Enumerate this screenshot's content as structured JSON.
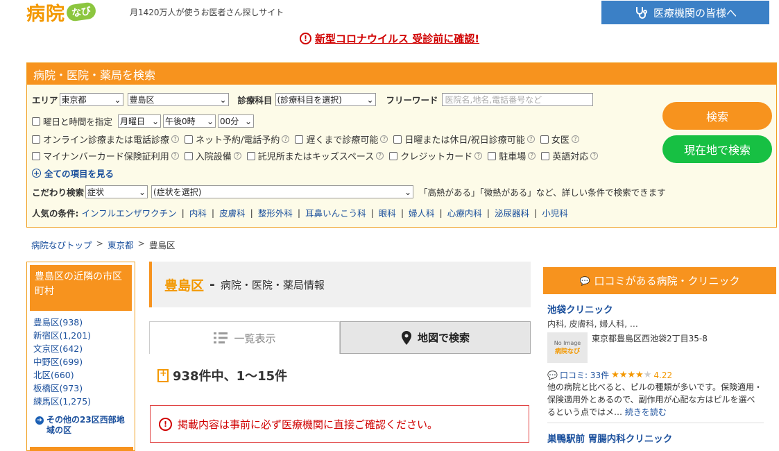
{
  "header": {
    "logo_main": "病院",
    "logo_badge": "なび",
    "tagline": "月1420万人が使うお医者さん探しサイト",
    "top_button": "医療機関の皆様へ",
    "alert": "新型コロナウイルス 受診前に確認!"
  },
  "search": {
    "title": "病院・医院・薬局を検索",
    "area_label": "エリア",
    "area_pref": "東京都",
    "area_city": "豊島区",
    "dept_label": "診療科目",
    "dept_value": "(診療科目を選択)",
    "freeword_label": "フリーワード",
    "freeword_placeholder": "医院名,地名,電話番号など",
    "day_time_label": "曜日と時間を指定",
    "day_value": "月曜日",
    "hour_value": "午後0時",
    "minute_value": "00分",
    "options_row1": [
      "オンライン診療または電話診療",
      "ネット予約/電話予約",
      "遅くまで診療可能",
      "日曜または休日/祝日診療可能",
      "女医"
    ],
    "options_row2": [
      "マイナンバーカード保険証利用",
      "入院設備",
      "託児所またはキッズスペース",
      "クレジットカード",
      "駐車場",
      "英語対応"
    ],
    "show_all": "全ての項目を見る",
    "kodawari_label": "こだわり検索",
    "kodawari_type": "症状",
    "kodawari_value": "(症状を選択)",
    "kodawari_hint": "「高熱がある」「微熱がある」など、詳しい条件で検索できます",
    "popular_label": "人気の条件:",
    "popular": [
      "インフルエンザワクチン",
      "内科",
      "皮膚科",
      "整形外科",
      "耳鼻いんこう科",
      "眼科",
      "婦人科",
      "心療内科",
      "泌尿器科",
      "小児科"
    ],
    "search_button": "検索",
    "geo_button": "現在地で検索"
  },
  "breadcrumb": [
    "病院なびトップ",
    "東京都",
    "豊島区"
  ],
  "sidebar": {
    "title": "豊島区の近隣の市区町村",
    "items": [
      "豊島区(938)",
      "新宿区(1,201)",
      "文京区(642)",
      "中野区(699)",
      "北区(660)",
      "板橋区(973)",
      "練馬区(1,275)"
    ],
    "more": "その他の23区西部地域の区"
  },
  "main": {
    "place": "豊島区",
    "dash": "-",
    "subtitle": "病院・医院・薬局情報",
    "tab_list": "一覧表示",
    "tab_map": "地図で検索",
    "count": "938件中、1〜15件",
    "notice": "掲載内容は事前に必ず医療機関に直接ご確認ください。"
  },
  "right": {
    "title": "口コミがある病院・クリニック",
    "clinic1": {
      "name": "池袋クリニック",
      "depts": "内科, 皮膚科, 婦人科, …",
      "noimage": "No Image",
      "noimage_brand": "病院なび",
      "address": "東京都豊島区西池袋2丁目35-8",
      "review_label": "口コミ: 33件",
      "rating": 4.22,
      "rating_text": "4.22",
      "review_text": "他の病院と比べると、ピルの種類が多いです。保険適用・保険適用外とあるので、副作用が心配な方はピルを選べるという点ではメ…",
      "read_more": "続きを読む"
    },
    "clinic2": {
      "name": "巣鴨駅前 胃腸内科クリニック"
    }
  },
  "colors": {
    "accent": "#f7931e",
    "blue": "#3b80c6",
    "green": "#17c043",
    "alert": "#d00000"
  }
}
